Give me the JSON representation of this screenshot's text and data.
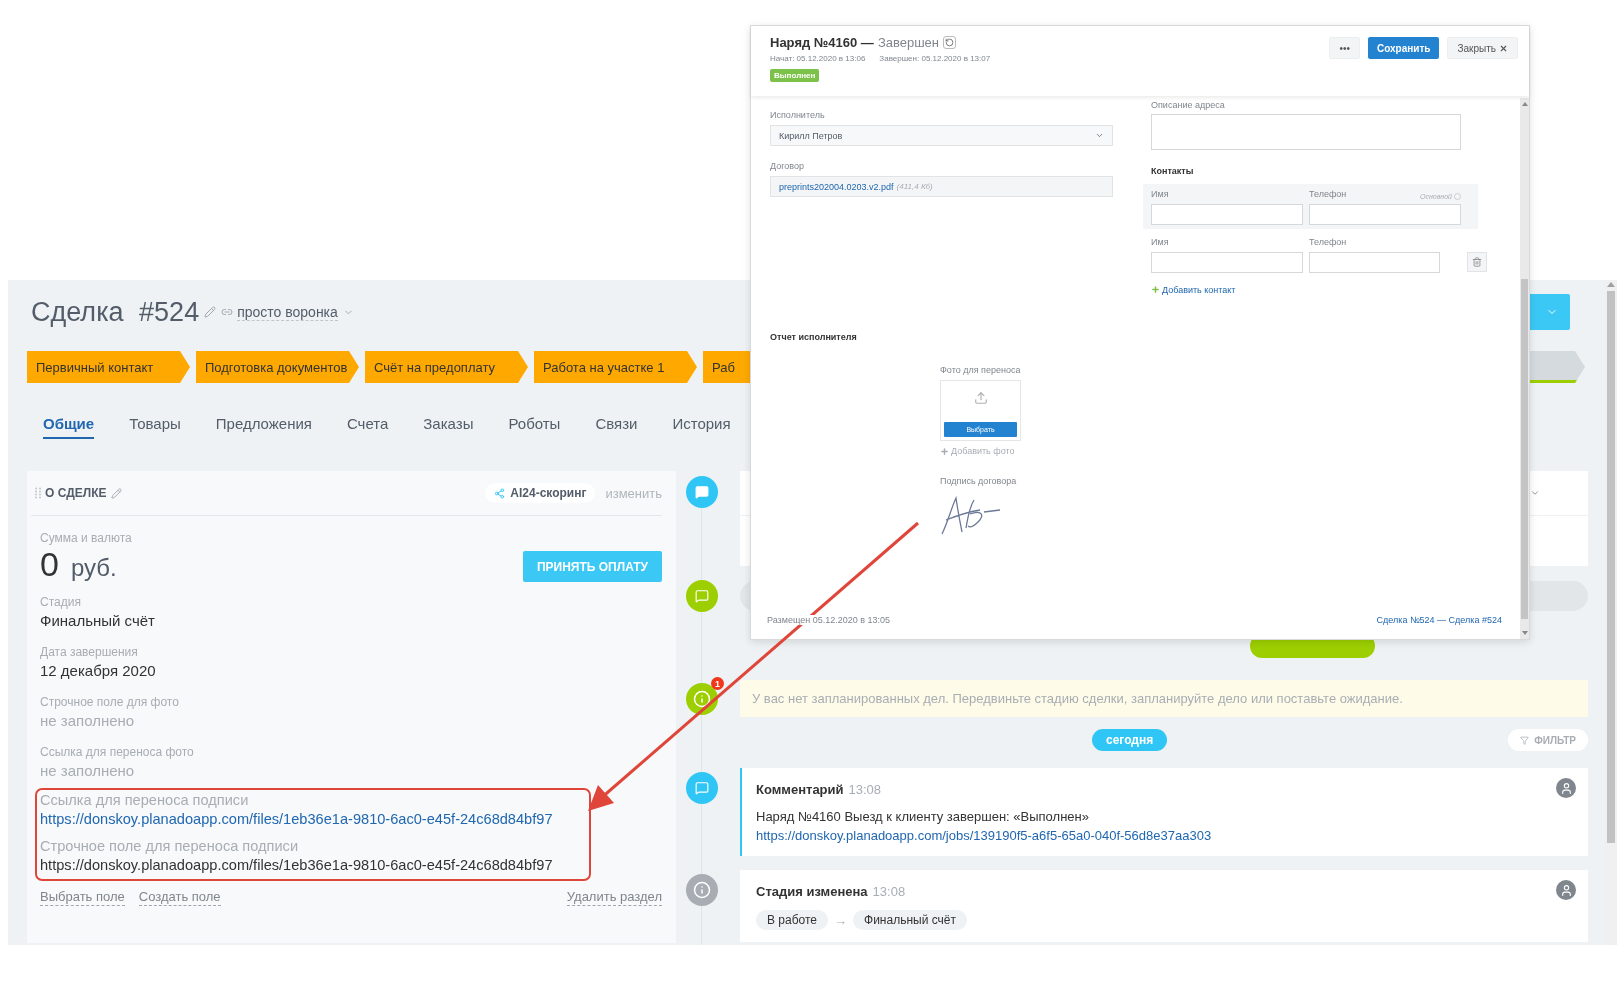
{
  "deal": {
    "title": "Сделка",
    "number": "#524",
    "pipeline": "просто воронка",
    "stages": [
      {
        "label": "Первичный контакт",
        "kind": "passed"
      },
      {
        "label": "Подготовка документов",
        "kind": "passed"
      },
      {
        "label": "Счёт на предоплату",
        "kind": "passed"
      },
      {
        "label": "Работа на участке 1",
        "kind": "passed"
      },
      {
        "label": "Раб",
        "kind": "passed"
      },
      {
        "kind": "final"
      }
    ],
    "tabs": [
      {
        "label": "Общие",
        "selected": true
      },
      {
        "label": "Товары",
        "selected": false
      },
      {
        "label": "Предложения",
        "selected": false
      },
      {
        "label": "Счета",
        "selected": false
      },
      {
        "label": "Заказы",
        "selected": false
      },
      {
        "label": "Роботы",
        "selected": false
      },
      {
        "label": "Связи",
        "selected": false
      },
      {
        "label": "История",
        "selected": false
      }
    ],
    "card": {
      "title": "О СДЕЛКЕ",
      "scoring": "AI24-скоринг",
      "edit": "изменить",
      "amount_label": "Сумма и валюта",
      "amount": "0",
      "currency": "руб.",
      "pay_button": "ПРИНЯТЬ ОПЛАТУ",
      "fields": [
        {
          "label": "Стадия",
          "value": "Финальный счёт",
          "kind": "text"
        },
        {
          "label": "Дата завершения",
          "value": "12 декабря 2020",
          "kind": "text"
        },
        {
          "label": "Строчное поле для фото",
          "value": "не заполнено",
          "kind": "empty"
        },
        {
          "label": "Ссылка для переноса фото",
          "value": "не заполнено",
          "kind": "empty"
        }
      ],
      "highlighted_fields": [
        {
          "label": "Ссылка для переноса подписи",
          "value": "https://donskoy.planadoapp.com/files/1eb36e1a-9810-6ac0-e45f-24c68d84bf97",
          "kind": "link"
        },
        {
          "label": "Строчное поле для переноса подписи",
          "value": "https://donskoy.planadoapp.com/files/1eb36e1a-9810-6ac0-e45f-24c68d84bf97",
          "kind": "text"
        }
      ],
      "actions": [
        "Выбрать поле",
        "Создать поле"
      ],
      "delete": "Удалить раздел"
    }
  },
  "timeline": {
    "notice": {
      "text": "У вас нет запланированных дел. Передвиньте стадию сделки, запланируйте дело или поставьте ожидание.",
      "badge": "1"
    },
    "today": "сегодня",
    "filter": "ФИЛЬТР",
    "events": [
      {
        "kind": "comment",
        "title": "Комментарий",
        "time": "13:08",
        "text": "Наряд №4160 Выезд к клиенту завершен: «Выполнен»",
        "link": "https://donskoy.planadoapp.com/jobs/139190f5-a6f5-65a0-040f-56d8e37aa303"
      },
      {
        "kind": "stage",
        "title": "Стадия изменена",
        "time": "13:08",
        "from": "В работе",
        "arrow": "→",
        "to": "Финальный счёт"
      }
    ]
  },
  "popup": {
    "title": "Наряд №4160 —",
    "status": "Завершен",
    "started": "Начат: 05.12.2020 в 13:06",
    "finished": "Завершен: 05.12.2020 в 13:07",
    "badge": "Выполнен",
    "more": "•••",
    "save": "Сохранить",
    "close": "Закрыть",
    "executor": {
      "label": "Исполнитель",
      "value": "Кирилл Петров"
    },
    "contract": {
      "label": "Договор",
      "file": "preprints202004.0203.v2.pdf",
      "size": "(411,4 Кб)"
    },
    "address": {
      "label": "Описание адреса"
    },
    "contacts": {
      "title": "Контакты",
      "rows": [
        {
          "name_label": "Имя",
          "phone_label": "Телефон",
          "primary": "Основной",
          "kind": "primary"
        },
        {
          "name_label": "Имя",
          "phone_label": "Телефон",
          "kind": "extra"
        }
      ],
      "add": "Добавить контакт"
    },
    "report": {
      "title": "Отчет исполнителя",
      "photo_label": "Фото для переноса",
      "choose": "Выбрать",
      "add_photo": "Добавить фото",
      "signature_label": "Подпись договора"
    },
    "footer": {
      "posted": "Размещен 05.12.2020 в 13:05",
      "link": "Сделка №524 — Сделка #524"
    }
  }
}
